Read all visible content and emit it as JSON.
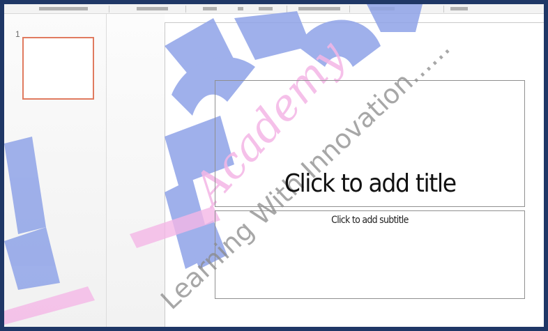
{
  "app": {
    "slide_number": "1"
  },
  "slide": {
    "title_placeholder": "Click to add title",
    "subtitle_placeholder": "Click to add subtitle"
  },
  "watermark": {
    "brand_text": "Academy",
    "tagline": "Learning With Innovation......"
  },
  "colors": {
    "frame_border": "#1f3766",
    "thumbnail_selected_border": "#e07a5f",
    "watermark_blue": "#8fa3e8",
    "watermark_pink": "#f4b6e6"
  }
}
